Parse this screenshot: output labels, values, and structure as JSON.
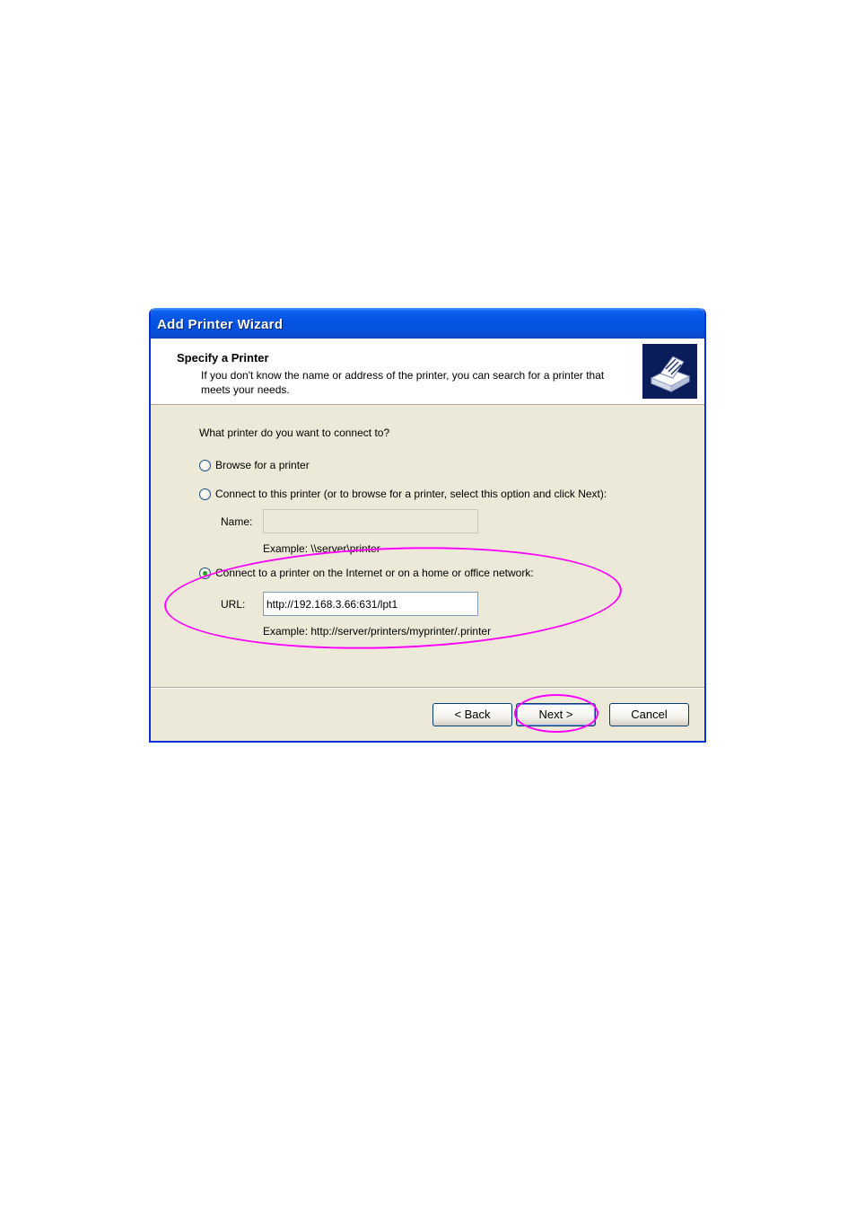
{
  "window": {
    "title": "Add Printer Wizard"
  },
  "header": {
    "title": "Specify a Printer",
    "description": "If you don't know the name or address of the printer, you can search for a printer that meets your needs.",
    "icon": "printer-icon"
  },
  "body": {
    "prompt": "What printer do you want to connect to?",
    "options": [
      {
        "label": "Browse for a printer",
        "checked": false
      },
      {
        "label": "Connect to this printer (or to browse for a printer, select this option and click Next):",
        "checked": false
      },
      {
        "label": "Connect to a printer on the Internet or on a home or office network:",
        "checked": true
      }
    ],
    "name_field": {
      "label": "Name:",
      "value": "",
      "example": "Example: \\\\server\\printer"
    },
    "url_field": {
      "label": "URL:",
      "value": "http://192.168.3.66:631/lpt1",
      "example": "Example: http://server/printers/myprinter/.printer"
    }
  },
  "buttons": {
    "back": "< Back",
    "next": "Next >",
    "cancel": "Cancel"
  },
  "colors": {
    "title_bar": "#0554e3",
    "highlight": "#ff00ff"
  }
}
